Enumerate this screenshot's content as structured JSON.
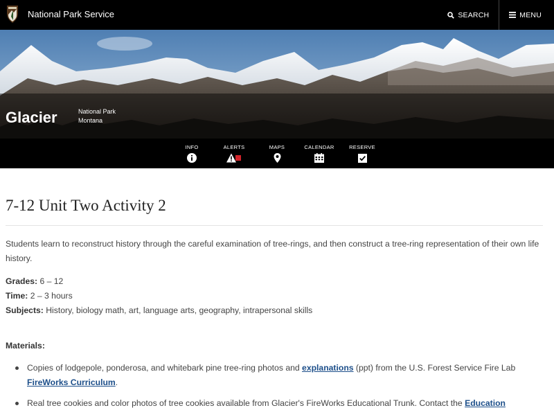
{
  "header": {
    "site_name": "National Park Service",
    "logo_icon": "nps-arrowhead-icon",
    "search_label": "SEARCH",
    "menu_label": "MENU"
  },
  "park": {
    "name": "Glacier",
    "designation": "National Park",
    "state": "Montana"
  },
  "quick_nav": [
    {
      "label": "INFO",
      "icon": "info-icon"
    },
    {
      "label": "ALERTS",
      "icon": "alert-icon",
      "badge": "1"
    },
    {
      "label": "MAPS",
      "icon": "map-pin-icon"
    },
    {
      "label": "CALENDAR",
      "icon": "calendar-icon"
    },
    {
      "label": "RESERVE",
      "icon": "checkbox-icon"
    }
  ],
  "page": {
    "title": "7-12 Unit Two Activity 2",
    "intro": "Students learn to reconstruct history through the careful examination of tree-rings, and then construct a tree-ring representation of their own life history.",
    "grades_label": "Grades:",
    "grades_value": "6 – 12",
    "time_label": "Time:",
    "time_value": "2 – 3 hours",
    "subjects_label": "Subjects:",
    "subjects_value": "History, biology math, art, language arts, geography, intrapersonal skills",
    "materials_heading": "Materials:",
    "materials": [
      {
        "text_before": "Copies of lodgepole, ponderosa, and whitebark pine tree-ring photos and ",
        "link1": "explanations",
        "text_middle": " (ppt) from the U.S. Forest Service Fire Lab ",
        "link2": "FireWorks Curriculum",
        "text_after": "."
      },
      {
        "text_before": "Real tree cookies and color photos of tree cookies available from Glacier's FireWorks Educational Trunk. Contact the ",
        "link1": "Education"
      }
    ]
  },
  "colors": {
    "header_bg": "#000000",
    "link": "#1d4f8a",
    "alert_badge": "#d2232a",
    "nps_brown": "#5b3a1e"
  }
}
